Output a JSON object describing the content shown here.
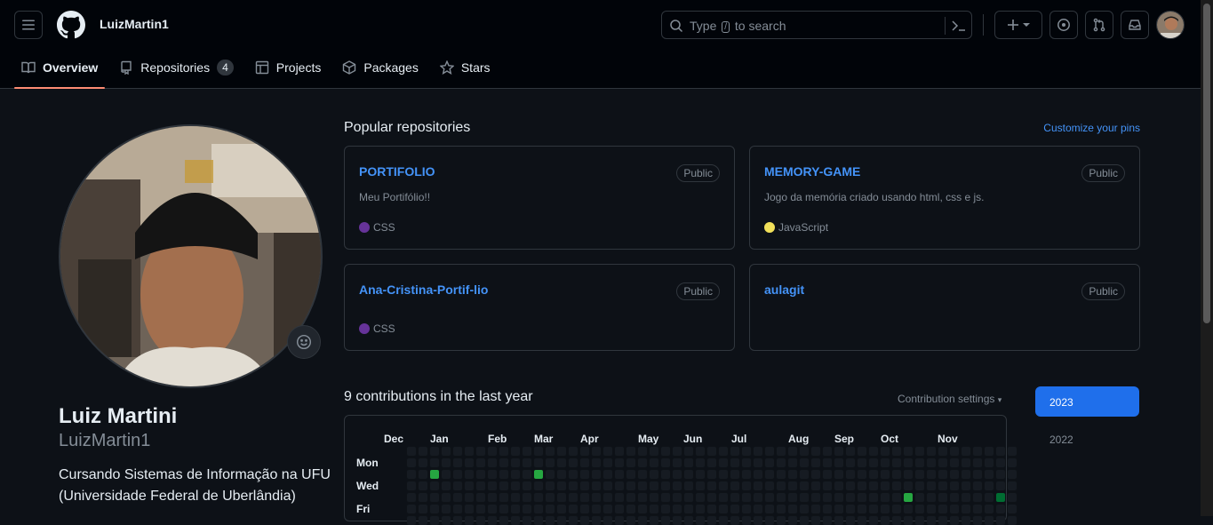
{
  "header": {
    "username": "LuizMartin1",
    "search": {
      "placeholder_before": "Type",
      "placeholder_key": "/",
      "placeholder_after": "to search"
    }
  },
  "tabs": [
    {
      "label": "Overview",
      "selected": true
    },
    {
      "label": "Repositories",
      "count": "4"
    },
    {
      "label": "Projects"
    },
    {
      "label": "Packages"
    },
    {
      "label": "Stars"
    }
  ],
  "profile": {
    "name": "Luiz Martini",
    "login": "LuizMartin1",
    "bio": "Cursando Sistemas de Informação na UFU (Universidade Federal de Uberlândia)"
  },
  "popular": {
    "title": "Popular repositories",
    "customize": "Customize your pins",
    "repos": [
      {
        "name": "PORTIFOLIO",
        "visibility": "Public",
        "description": "Meu Portifólio!!",
        "language": "CSS",
        "lang_color": "#663399"
      },
      {
        "name": "MEMORY-GAME",
        "visibility": "Public",
        "description": "Jogo da memória criado usando html, css e js.",
        "language": "JavaScript",
        "lang_color": "#f1e05a"
      },
      {
        "name": "Ana-Cristina-Portif-lio",
        "visibility": "Public",
        "description": "",
        "language": "CSS",
        "lang_color": "#663399"
      },
      {
        "name": "aulagit",
        "visibility": "Public",
        "description": "",
        "language": "",
        "lang_color": ""
      }
    ]
  },
  "contributions": {
    "title": "9 contributions in the last year",
    "settings": "Contribution settings",
    "months": [
      "Dec",
      "Jan",
      "Feb",
      "Mar",
      "Apr",
      "May",
      "Jun",
      "Jul",
      "Aug",
      "Sep",
      "Oct",
      "Nov"
    ],
    "days": [
      "Mon",
      "Wed",
      "Fri"
    ],
    "active_cells": [
      {
        "week": 2,
        "day": 2,
        "level": 3
      },
      {
        "week": 11,
        "day": 2,
        "level": 3
      },
      {
        "week": 43,
        "day": 4,
        "level": 3
      },
      {
        "week": 51,
        "day": 4,
        "level": 2
      }
    ],
    "years": [
      "2023",
      "2022"
    ]
  },
  "colors": {
    "accent": "#4493f8",
    "selected_tab": "#fd8c73",
    "year_selected": "#1f6feb"
  }
}
